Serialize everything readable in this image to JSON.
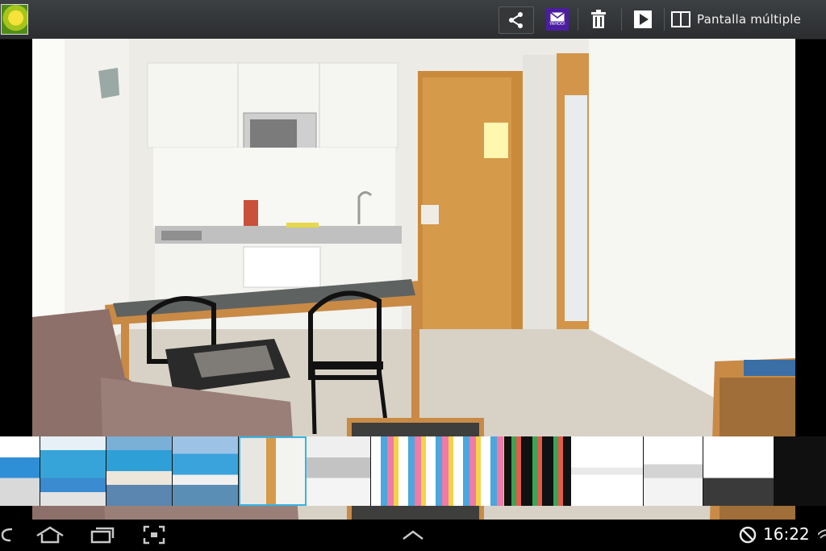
{
  "toolbar": {
    "multi_window_label": "Pantalla múltiple",
    "mail_badge_text": "YAHOO!"
  },
  "status": {
    "time": "16:22"
  },
  "colors": {
    "selected_border": "#34b5e5",
    "mail_bg": "#4b1ea0"
  },
  "icons": [
    "share-icon",
    "mail-icon",
    "trash-icon",
    "play-icon",
    "multi-window-icon",
    "back-icon",
    "home-icon",
    "recent-apps-icon",
    "screenshot-icon",
    "up-arrow-icon",
    "no-sync-icon",
    "wifi-icon"
  ],
  "filmstrip": {
    "count": 12,
    "selected_index": 4
  }
}
